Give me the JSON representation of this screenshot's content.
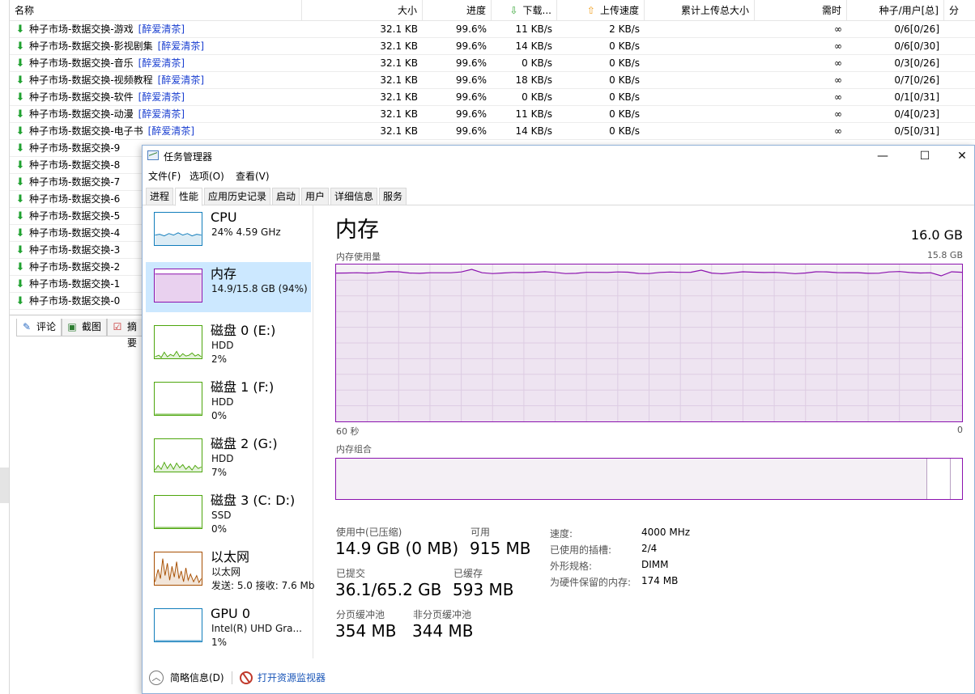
{
  "torrent_client": {
    "headers": {
      "name": "名称",
      "size": "大小",
      "progress": "进度",
      "download": "下载...",
      "upload_speed": "上传速度",
      "total_uploaded": "累计上传总大小",
      "eta": "需时",
      "seeds_peers": "种子/用户[总]",
      "share": "分"
    },
    "rows": [
      {
        "name": "种子市场-数据交换-游戏",
        "tag": "[醉爱清茶]",
        "size": "32.1 KB",
        "progress": "99.6%",
        "down": "11 KB/s",
        "up": "2 KB/s",
        "eta": "∞",
        "peers": "0/6[0/26]"
      },
      {
        "name": "种子市场-数据交换-影视剧集",
        "tag": "[醉爱清茶]",
        "size": "32.1 KB",
        "progress": "99.6%",
        "down": "14 KB/s",
        "up": "0 KB/s",
        "eta": "∞",
        "peers": "0/6[0/30]"
      },
      {
        "name": "种子市场-数据交换-音乐",
        "tag": "[醉爱清茶]",
        "size": "32.1 KB",
        "progress": "99.6%",
        "down": "0 KB/s",
        "up": "0 KB/s",
        "eta": "∞",
        "peers": "0/3[0/26]"
      },
      {
        "name": "种子市场-数据交换-视频教程",
        "tag": "[醉爱清茶]",
        "size": "32.1 KB",
        "progress": "99.6%",
        "down": "18 KB/s",
        "up": "0 KB/s",
        "eta": "∞",
        "peers": "0/7[0/26]"
      },
      {
        "name": "种子市场-数据交换-软件",
        "tag": "[醉爱清茶]",
        "size": "32.1 KB",
        "progress": "99.6%",
        "down": "0 KB/s",
        "up": "0 KB/s",
        "eta": "∞",
        "peers": "0/1[0/31]"
      },
      {
        "name": "种子市场-数据交换-动漫",
        "tag": "[醉爱清茶]",
        "size": "32.1 KB",
        "progress": "99.6%",
        "down": "11 KB/s",
        "up": "0 KB/s",
        "eta": "∞",
        "peers": "0/4[0/23]"
      },
      {
        "name": "种子市场-数据交换-电子书",
        "tag": "[醉爱清茶]",
        "size": "32.1 KB",
        "progress": "99.6%",
        "down": "14 KB/s",
        "up": "0 KB/s",
        "eta": "∞",
        "peers": "0/5[0/31]"
      },
      {
        "name": "种子市场-数据交换-9"
      },
      {
        "name": "种子市场-数据交换-8"
      },
      {
        "name": "种子市场-数据交换-7"
      },
      {
        "name": "种子市场-数据交换-6"
      },
      {
        "name": "种子市场-数据交换-5"
      },
      {
        "name": "种子市场-数据交换-4"
      },
      {
        "name": "种子市场-数据交换-3"
      },
      {
        "name": "种子市场-数据交换-2"
      },
      {
        "name": "种子市场-数据交换-1"
      },
      {
        "name": "种子市场-数据交换-0"
      }
    ],
    "bottom_tabs": [
      "评论",
      "截图",
      "摘要"
    ]
  },
  "task_manager": {
    "title": "任务管理器",
    "window_controls": {
      "minimize": "—",
      "maximize": "☐",
      "close": "✕"
    },
    "menu": [
      "文件(F)",
      "选项(O)",
      "查看(V)"
    ],
    "tabs": [
      "进程",
      "性能",
      "应用历史记录",
      "启动",
      "用户",
      "详细信息",
      "服务"
    ],
    "active_tab": "性能",
    "devices": [
      {
        "name": "CPU",
        "sub1": "24%  4.59 GHz",
        "sub2": "",
        "color": "#117dbb"
      },
      {
        "name": "内存",
        "sub1": "14.9/15.8 GB (94%)",
        "sub2": "",
        "color": "#8b12ae",
        "selected": true
      },
      {
        "name": "磁盘 0 (E:)",
        "sub1": "HDD",
        "sub2": "2%",
        "color": "#4da60c"
      },
      {
        "name": "磁盘 1 (F:)",
        "sub1": "HDD",
        "sub2": "0%",
        "color": "#4da60c"
      },
      {
        "name": "磁盘 2 (G:)",
        "sub1": "HDD",
        "sub2": "7%",
        "color": "#4da60c"
      },
      {
        "name": "磁盘 3 (C: D:)",
        "sub1": "SSD",
        "sub2": "0%",
        "color": "#4da60c"
      },
      {
        "name": "以太网",
        "sub1": "以太网",
        "sub2": "发送: 5.0  接收: 7.6 Mb",
        "color": "#a74f01"
      },
      {
        "name": "GPU 0",
        "sub1": "Intel(R) UHD Gra...",
        "sub2": "1%",
        "color": "#117dbb"
      }
    ],
    "memory": {
      "title": "内存",
      "total": "16.0 GB",
      "usage_label": "内存使用量",
      "usage_max": "15.8 GB",
      "time_left": "60 秒",
      "time_right": "0",
      "composition_label": "内存组合",
      "in_use_fraction": 0.943,
      "cached_fraction": 0.037,
      "stats": {
        "in_use_label": "使用中(已压缩)",
        "in_use_value": "14.9 GB (0 MB)",
        "available_label": "可用",
        "available_value": "915 MB",
        "committed_label": "已提交",
        "committed_value": "36.1/65.2 GB",
        "cached_label": "已缓存",
        "cached_value": "593 MB",
        "paged_label": "分页缓冲池",
        "paged_value": "354 MB",
        "nonpaged_label": "非分页缓冲池",
        "nonpaged_value": "344 MB"
      },
      "props": [
        {
          "label": "速度:",
          "value": "4000 MHz"
        },
        {
          "label": "已使用的插槽:",
          "value": "2/4"
        },
        {
          "label": "外形规格:",
          "value": "DIMM"
        },
        {
          "label": "为硬件保留的内存:",
          "value": "174 MB"
        }
      ]
    },
    "footer": {
      "fewer_details": "简略信息(D)",
      "resource_monitor": "打开资源监视器"
    }
  }
}
